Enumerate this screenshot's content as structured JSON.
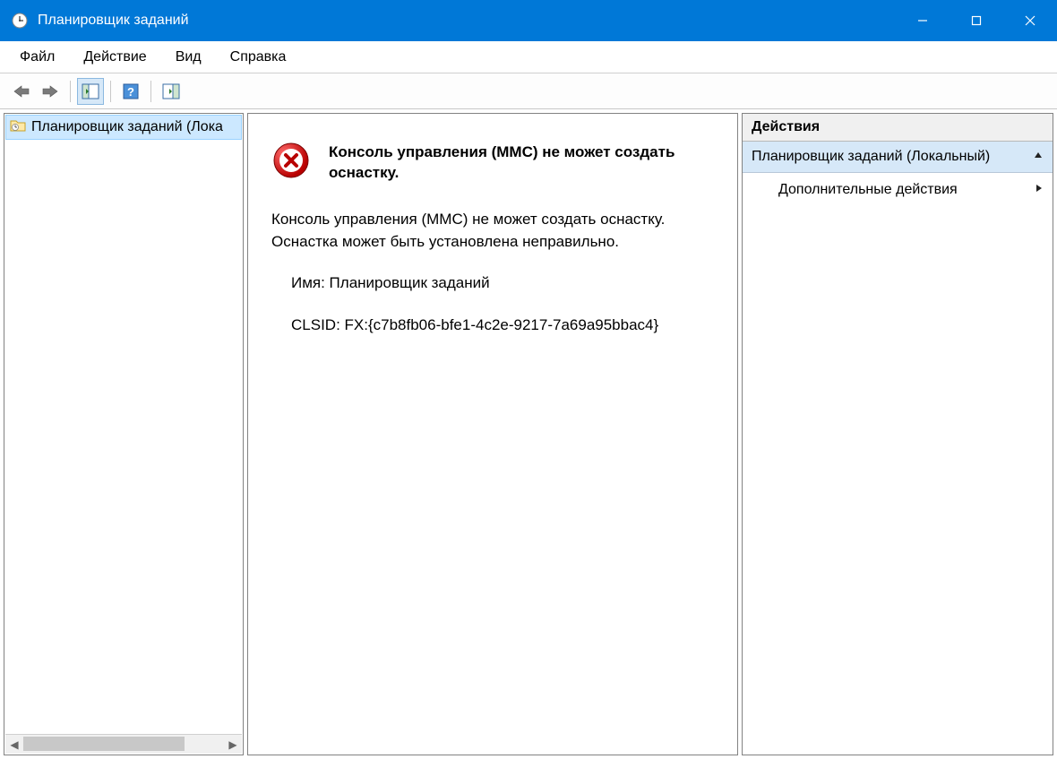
{
  "window": {
    "title": "Планировщик заданий"
  },
  "menu": {
    "file": "Файл",
    "action": "Действие",
    "view": "Вид",
    "help": "Справка"
  },
  "tree": {
    "root_label": "Планировщик заданий (Лока"
  },
  "error": {
    "title": "Консоль управления (MMC) не может создать оснастку.",
    "body_line1": "Консоль управления (MMC) не может создать оснастку.",
    "body_line2": "Оснастка может быть установлена неправильно.",
    "name_line": "Имя: Планировщик заданий",
    "clsid_line": "CLSID: FX:{c7b8fb06-bfe1-4c2e-9217-7a69a95bbac4}"
  },
  "actions": {
    "header": "Действия",
    "section": "Планировщик заданий (Локальный)",
    "item_more": "Дополнительные действия"
  }
}
